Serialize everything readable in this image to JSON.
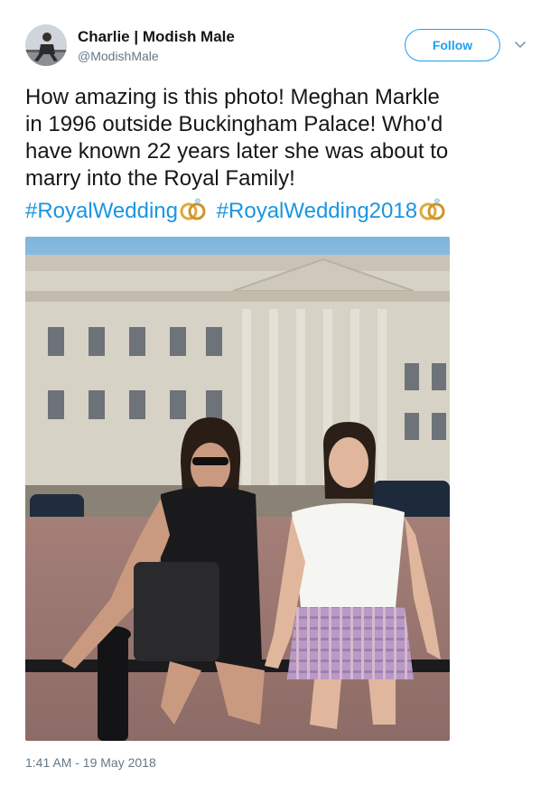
{
  "author": {
    "name": "Charlie | Modish Male",
    "handle": "@ModishMale"
  },
  "actions": {
    "follow_label": "Follow"
  },
  "tweet": {
    "lines": [
      "How amazing is this photo! Meghan Markle",
      "in 1996 outside Buckingham Palace! Who'd",
      "have known 22 years later she was about to",
      "marry into the Royal Family!"
    ],
    "hashtags": [
      "#RoyalWedding",
      "#RoyalWedding2018"
    ],
    "timestamp": "1:41 AM - 19 May 2018"
  },
  "icons": {
    "caret": "chevron-down-icon",
    "emoji": "wedding-rings-icon"
  },
  "colors": {
    "link": "#1b95e0",
    "follow": "#1da1f2",
    "secondary_text": "#657786",
    "ring_gold": "#e0a93a"
  }
}
